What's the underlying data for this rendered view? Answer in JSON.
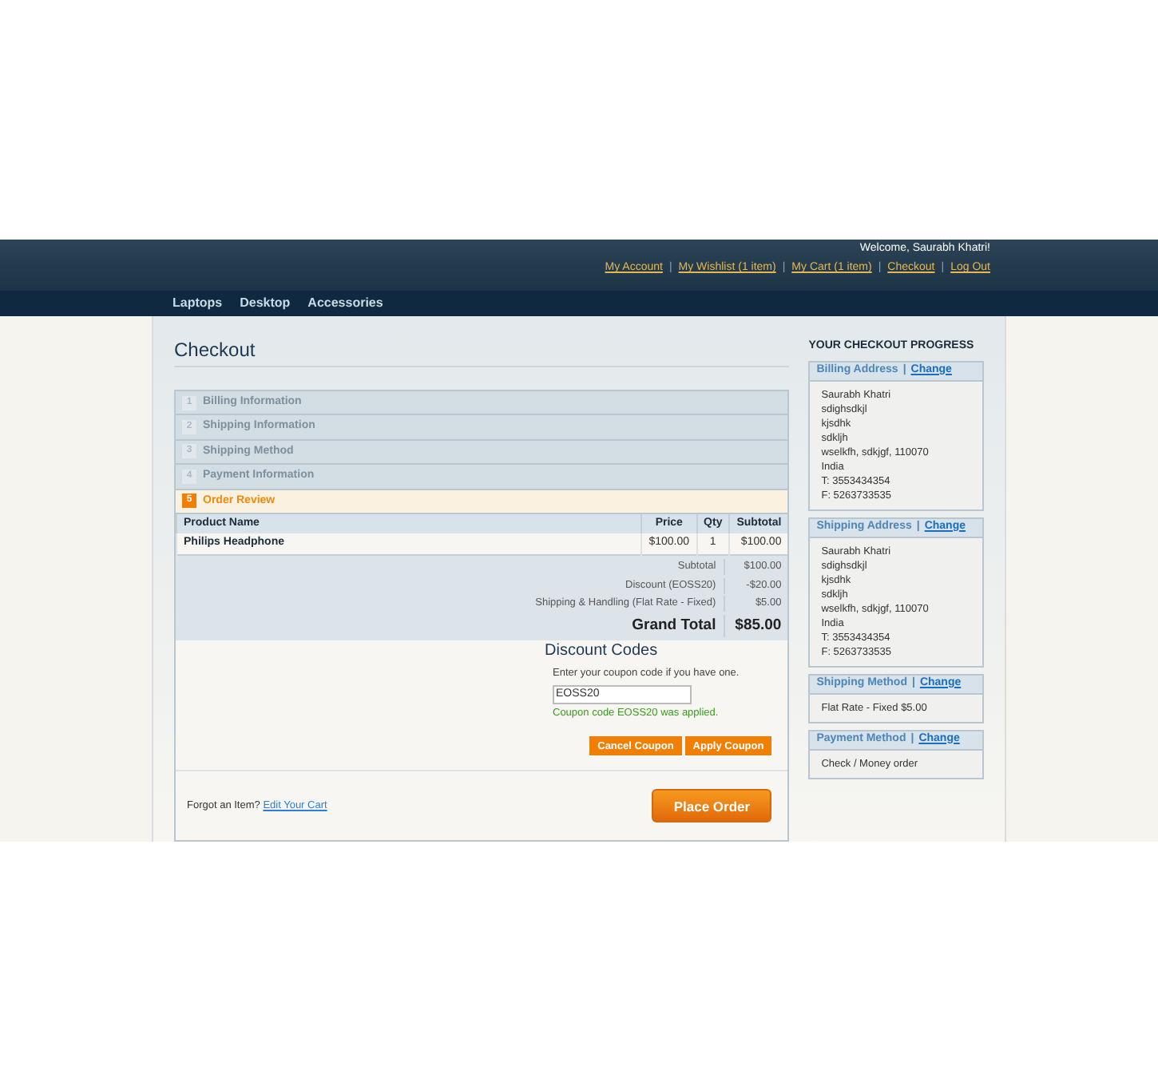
{
  "header": {
    "welcome": "Welcome, Saurabh Khatri!",
    "separator": "|",
    "links": [
      "My Account",
      "My Wishlist (1 item)",
      "My Cart (1 item)",
      "Checkout",
      "Log Out"
    ],
    "nav": [
      "Laptops",
      "Desktop",
      "Accessories"
    ]
  },
  "title": "Checkout",
  "steps": [
    {
      "number": "1",
      "label": "Billing Information",
      "selected": false
    },
    {
      "number": "2",
      "label": "Shipping Information",
      "selected": false
    },
    {
      "number": "3",
      "label": "Shipping Method",
      "selected": false
    },
    {
      "number": "4",
      "label": "Payment Information",
      "selected": false
    },
    {
      "number": "5",
      "label": "Order Review",
      "selected": true
    }
  ],
  "table": {
    "columns": [
      "Product Name",
      "Price",
      "Qty",
      "Subtotal"
    ],
    "rows": [
      [
        "Philips Headphone",
        "$100.00",
        "1",
        "$100.00"
      ]
    ],
    "totals": [
      {
        "label": "Subtotal",
        "value": "$100.00",
        "kind": "normal"
      },
      {
        "label": "Discount (EOSS20)",
        "value": "-$20.00",
        "kind": "normal"
      },
      {
        "label": "Shipping & Handling (Flat Rate - Fixed)",
        "value": "$5.00",
        "kind": "normal"
      },
      {
        "label": "Grand Total",
        "value": "$85.00",
        "kind": "grand"
      }
    ]
  },
  "discount": {
    "title": "Discount Codes",
    "hint": "Enter your coupon code if you have one.",
    "value": "EOSS20",
    "message": "Coupon code EOSS20 was applied.",
    "buttons": [
      "Cancel Coupon",
      "Apply Coupon"
    ]
  },
  "footer": {
    "text": "Forgot an Item?",
    "link": "Edit Your Cart",
    "button": "Place Order"
  },
  "progress": {
    "title": "YOUR CHECKOUT PROGRESS",
    "separator": "|",
    "sections": [
      {
        "title": "Billing Address",
        "change": "Change",
        "lines": [
          "Saurabh Khatri",
          "sdighsdkjl",
          "kjsdhk",
          "sdkljh",
          "wselkfh, sdkjgf, 110070",
          "India",
          "T: 3553434354",
          "F: 5263733535"
        ]
      },
      {
        "title": "Shipping Address",
        "change": "Change",
        "lines": [
          "Saurabh Khatri",
          "sdighsdkjl",
          "kjsdhk",
          "sdkljh",
          "wselkfh, sdkjgf, 110070",
          "India",
          "T: 3553434354",
          "F: 5263733535"
        ]
      },
      {
        "title": "Shipping Method",
        "change": "Change",
        "lines": [
          "Flat Rate - Fixed $5.00"
        ]
      },
      {
        "title": "Payment Method",
        "change": "Change",
        "lines": [
          "Check / Money order"
        ]
      }
    ]
  }
}
